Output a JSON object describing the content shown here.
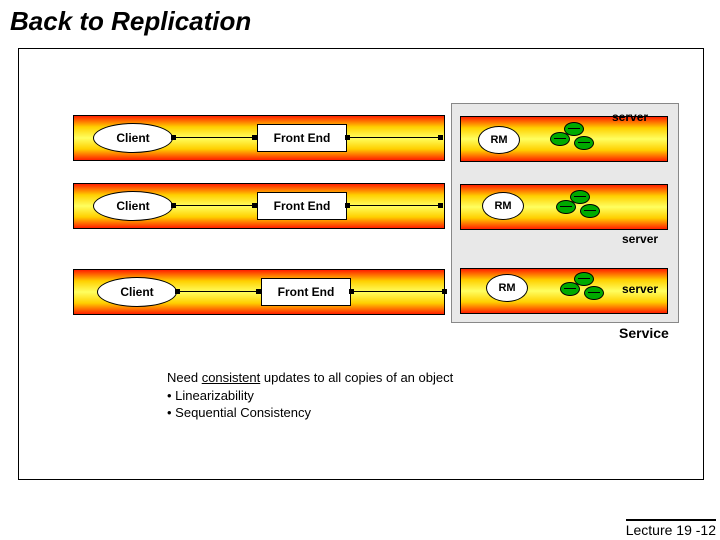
{
  "title": "Back to Replication",
  "clientLabel": "Client",
  "frontEndLabel": "Front End",
  "rmLabel": "RM",
  "serverLabel": "server",
  "serviceLabel": "Service",
  "notes": {
    "line1a": "Need ",
    "line1b": "consistent",
    "line1c": " updates to all copies of an object",
    "bullet1": "• Linearizability",
    "bullet2": "• Sequential Consistency"
  },
  "lecture": "Lecture 19 -12"
}
